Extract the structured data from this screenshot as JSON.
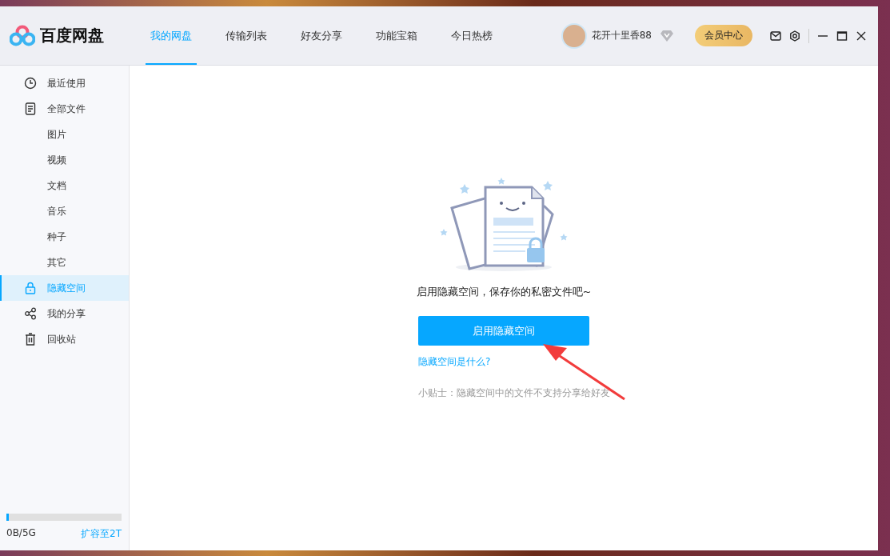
{
  "app": {
    "name": "百度网盘"
  },
  "tabs": [
    {
      "label": "我的网盘",
      "selected": true
    },
    {
      "label": "传输列表",
      "selected": false
    },
    {
      "label": "好友分享",
      "selected": false
    },
    {
      "label": "功能宝箱",
      "selected": false
    },
    {
      "label": "今日热榜",
      "selected": false
    }
  ],
  "user": {
    "name": "花开十里香88",
    "vip_button": "会员中心"
  },
  "sidebar": {
    "items": [
      {
        "label": "最近使用",
        "selected": false
      },
      {
        "label": "全部文件",
        "selected": false,
        "children": [
          {
            "label": "图片",
            "selected": false
          },
          {
            "label": "视频",
            "selected": false
          },
          {
            "label": "文档",
            "selected": false
          },
          {
            "label": "音乐",
            "selected": false
          },
          {
            "label": "种子",
            "selected": false
          },
          {
            "label": "其它",
            "selected": false
          }
        ]
      },
      {
        "label": "隐藏空间",
        "selected": true
      },
      {
        "label": "我的分享",
        "selected": false
      },
      {
        "label": "回收站",
        "selected": false
      }
    ],
    "storage": {
      "level": 0.02,
      "used": "0B/5G",
      "upgrade_link": "扩容至2T"
    }
  },
  "main": {
    "message": "启用隐藏空间，保存你的私密文件吧~",
    "primary_button": "启用隐藏空间",
    "help_link": "隐藏空间是什么?",
    "tip": "小贴士：隐藏空间中的文件不支持分享给好友"
  }
}
